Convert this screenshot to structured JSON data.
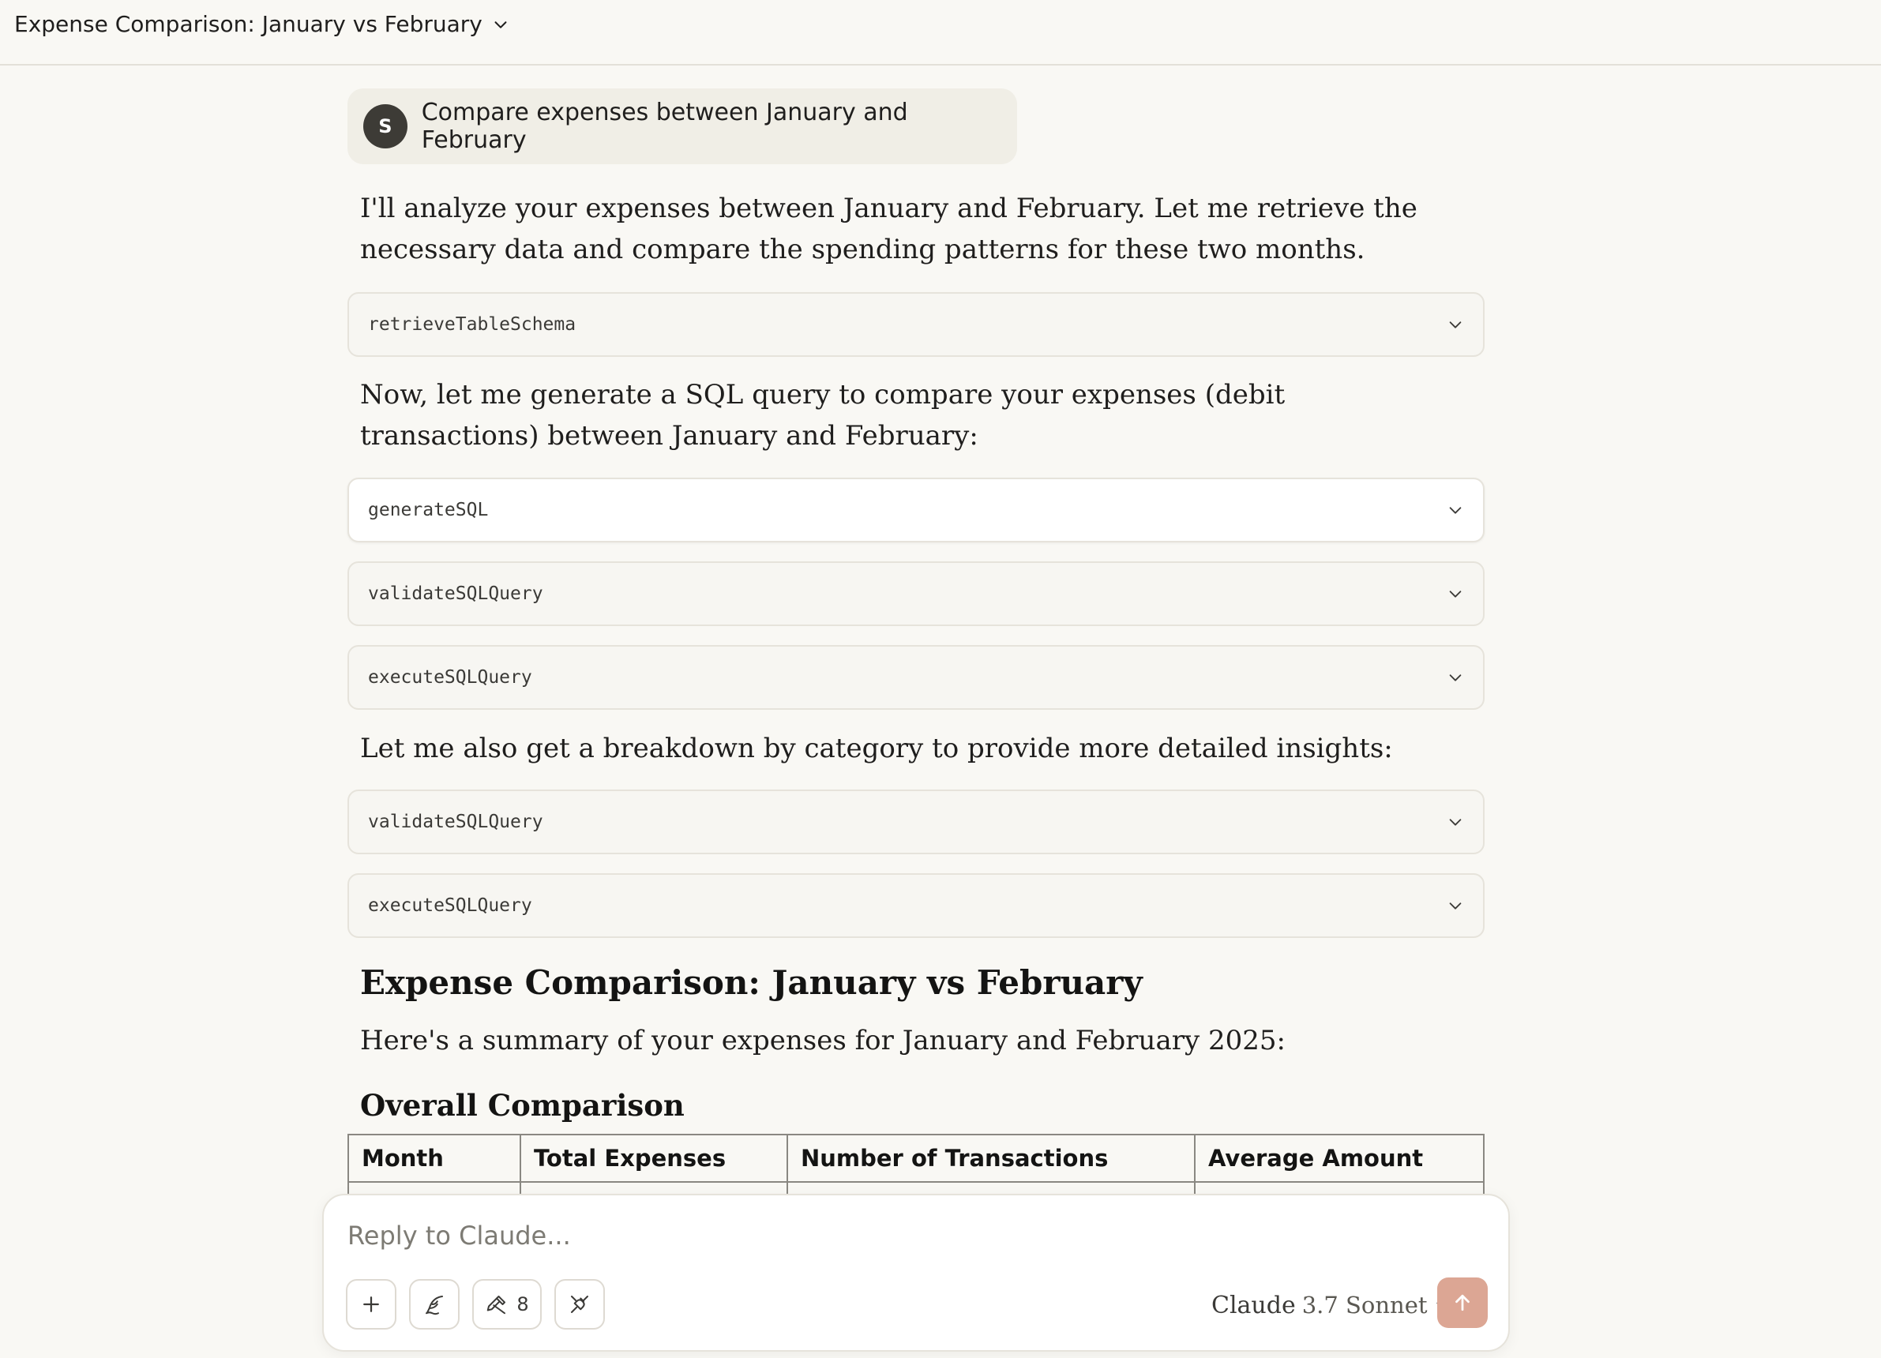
{
  "header": {
    "title": "Expense Comparison: January vs February"
  },
  "conversation": {
    "user_message": {
      "avatar_initial": "S",
      "text": "Compare expenses between January and February"
    },
    "paragraphs": [
      "I'll analyze your expenses between January and February. Let me retrieve the necessary data and compare the spending patterns for these two months.",
      "Now, let me generate a SQL query to compare your expenses (debit transactions) between January and February:",
      "Let me also get a breakdown by category to provide more detailed insights:"
    ],
    "tools": [
      {
        "name": "retrieveTableSchema"
      },
      {
        "name": "generateSQL"
      },
      {
        "name": "validateSQLQuery"
      },
      {
        "name": "executeSQLQuery"
      },
      {
        "name": "validateSQLQuery"
      },
      {
        "name": "executeSQLQuery"
      }
    ],
    "heading": "Expense Comparison: January vs February",
    "summary": "Here's a summary of your expenses for January and February 2025:",
    "subheading": "Overall Comparison",
    "table": {
      "columns": [
        "Month",
        "Total Expenses",
        "Number of Transactions",
        "Average Amount"
      ]
    }
  },
  "composer": {
    "placeholder": "Reply to Claude...",
    "tools_count": "8",
    "model_name": "Claude",
    "model_version": "3.7 Sonnet"
  },
  "colors": {
    "background": "#f9f8f4",
    "send_button": "#dca694",
    "user_bubble": "#f0eee6"
  }
}
